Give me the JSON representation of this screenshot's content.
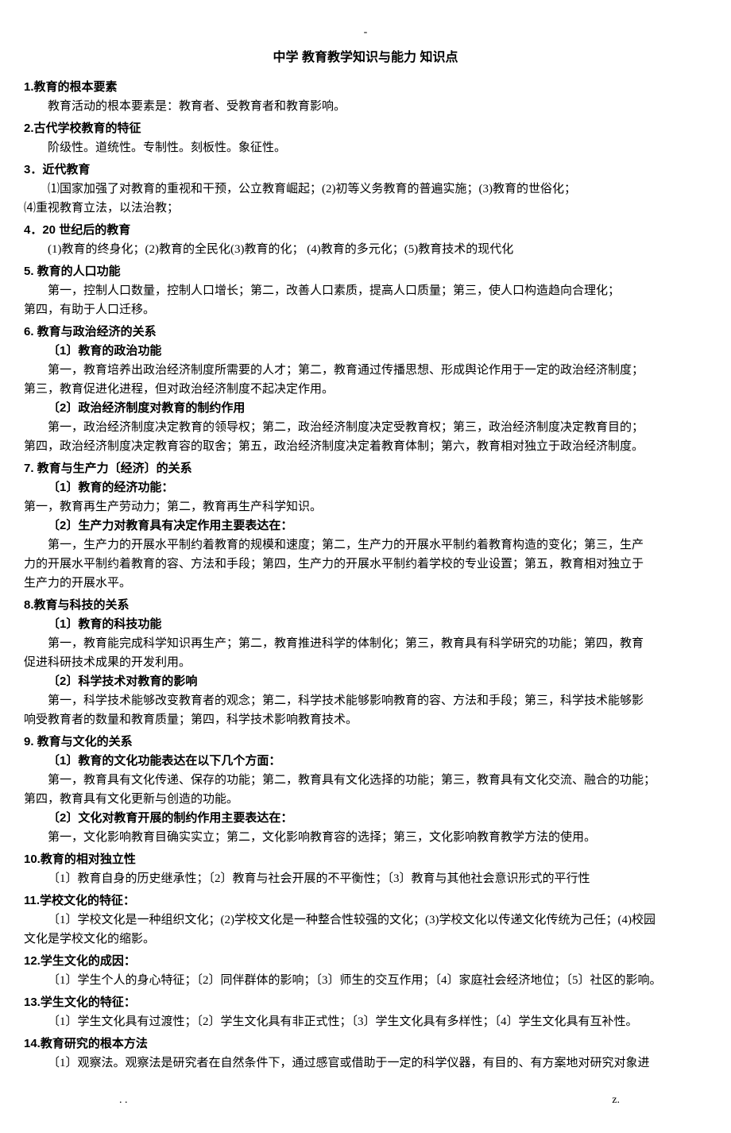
{
  "header_dash": "-",
  "title": "中学 教育教学知识与能力 知识点",
  "sections": [
    {
      "h": "1.教育的根本要素",
      "body": [
        {
          "t": "p",
          "v": "教育活动的根本要素是：教育者、受教育者和教育影响。"
        }
      ]
    },
    {
      "h": "2.古代学校教育的特征",
      "body": [
        {
          "t": "p",
          "v": "阶级性。道统性。专制性。刻板性。象征性。"
        }
      ]
    },
    {
      "h": "3．近代教育",
      "body": [
        {
          "t": "p",
          "v": "⑴国家加强了对教育的重视和干预，公立教育崛起；(2)初等义务教育的普遍实施；(3)教育的世俗化；"
        },
        {
          "t": "p-ni",
          "v": "⑷重视教育立法，以法治教；"
        }
      ]
    },
    {
      "h": "4．20 世纪后的教育",
      "body": [
        {
          "t": "p",
          "v": "(1)教育的终身化；(2)教育的全民化(3)教育的化； (4)教育的多元化；(5)教育技术的现代化"
        }
      ]
    },
    {
      "h": "5. 教育的人口功能",
      "body": [
        {
          "t": "p",
          "v": "第一，控制人口数量，控制人口增长；第二，改善人口素质，提高人口质量；第三，使人口构造趋向合理化；"
        },
        {
          "t": "p-ni",
          "v": "第四，有助于人口迁移。"
        }
      ]
    },
    {
      "h": "6. 教育与政治经济的关系",
      "body": [
        {
          "t": "sh",
          "v": "〔1〕教育的政治功能"
        },
        {
          "t": "p",
          "v": "第一，教育培养出政治经济制度所需要的人才；第二，教育通过传播思想、形成舆论作用于一定的政治经济制度；"
        },
        {
          "t": "p-ni",
          "v": "第三，教育促进化进程，但对政治经济制度不起决定作用。"
        },
        {
          "t": "sh",
          "v": "〔2〕政治经济制度对教育的制约作用"
        },
        {
          "t": "p",
          "v": "第一，政治经济制度决定教育的领导权；第二，政治经济制度决定受教育权；第三，政治经济制度决定教育目的；"
        },
        {
          "t": "p-ni",
          "v": "第四，政治经济制度决定教育容的取舍；第五，政治经济制度决定着教育体制；第六，教育相对独立于政治经济制度。"
        }
      ]
    },
    {
      "h": "7. 教育与生产力〔经济〕的关系",
      "body": [
        {
          "t": "sh",
          "v": "〔1〕教育的经济功能："
        },
        {
          "t": "p-ni",
          "v": "第一，教育再生产劳动力；第二，教育再生产科学知识。"
        },
        {
          "t": "sh",
          "v": "〔2〕生产力对教育具有决定作用主要表达在："
        },
        {
          "t": "p",
          "v": "第一，生产力的开展水平制约着教育的规模和速度；第二，生产力的开展水平制约着教育构造的变化；第三，生产"
        },
        {
          "t": "p-ni",
          "v": "力的开展水平制约着教育的容、方法和手段；第四，生产力的开展水平制约着学校的专业设置；第五，教育相对独立于"
        },
        {
          "t": "p-ni",
          "v": "生产力的开展水平。"
        }
      ]
    },
    {
      "h": "8.教育与科技的关系",
      "body": [
        {
          "t": "sh",
          "v": "〔1〕教育的科技功能"
        },
        {
          "t": "p",
          "v": "第一，教育能完成科学知识再生产；第二，教育推进科学的体制化；第三，教育具有科学研究的功能；第四，教育"
        },
        {
          "t": "p-ni",
          "v": "促进科研技术成果的开发利用。"
        },
        {
          "t": "sh",
          "v": "〔2〕科学技术对教育的影响"
        },
        {
          "t": "p",
          "v": "第一，科学技术能够改变教育者的观念；第二，科学技术能够影响教育的容、方法和手段；第三，科学技术能够影"
        },
        {
          "t": "p-ni",
          "v": "响受教育者的数量和教育质量；第四，科学技术影响教育技术。"
        }
      ]
    },
    {
      "h": "9. 教育与文化的关系",
      "body": [
        {
          "t": "sh",
          "v": "〔1〕教育的文化功能表达在以下几个方面："
        },
        {
          "t": "p",
          "v": "第一，教育具有文化传递、保存的功能；第二，教育具有文化选择的功能；第三，教育具有文化交流、融合的功能；"
        },
        {
          "t": "p-ni",
          "v": "第四，教育具有文化更新与创造的功能。"
        },
        {
          "t": "sh",
          "v": "〔2〕文化对教育开展的制约作用主要表达在："
        },
        {
          "t": "p",
          "v": "第一，文化影响教育目确实实立；第二，文化影响教育容的选择；第三，文化影响教育教学方法的使用。"
        }
      ]
    },
    {
      "h": "10.教育的相对独立性",
      "body": [
        {
          "t": "p",
          "v": "〔1〕教育自身的历史继承性；〔2〕教育与社会开展的不平衡性；〔3〕教育与其他社会意识形式的平行性"
        }
      ]
    },
    {
      "h": "11.学校文化的特征：",
      "body": [
        {
          "t": "p",
          "v": "〔1〕学校文化是一种组织文化；(2)学校文化是一种整合性较强的文化；(3)学校文化以传递文化传统为己任；(4)校园"
        },
        {
          "t": "p-ni",
          "v": "文化是学校文化的缩影。"
        }
      ]
    },
    {
      "h": "12.学生文化的成因：",
      "body": [
        {
          "t": "p",
          "v": "〔1〕学生个人的身心特征；〔2〕同伴群体的影响；〔3〕师生的交互作用；〔4〕家庭社会经济地位；〔5〕社区的影响。"
        }
      ]
    },
    {
      "h": "13.学生文化的特征：",
      "body": [
        {
          "t": "p",
          "v": "〔1〕学生文化具有过渡性；〔2〕学生文化具有非正式性；〔3〕学生文化具有多样性；〔4〕学生文化具有互补性。"
        }
      ]
    },
    {
      "h": "14.教育研究的根本方法",
      "body": [
        {
          "t": "p",
          "v": "〔1〕观察法。观察法是研究者在自然条件下，通过感官或借助于一定的科学仪器，有目的、有方案地对研究对象进"
        }
      ]
    }
  ],
  "footer_left": ". .",
  "footer_right": "z."
}
